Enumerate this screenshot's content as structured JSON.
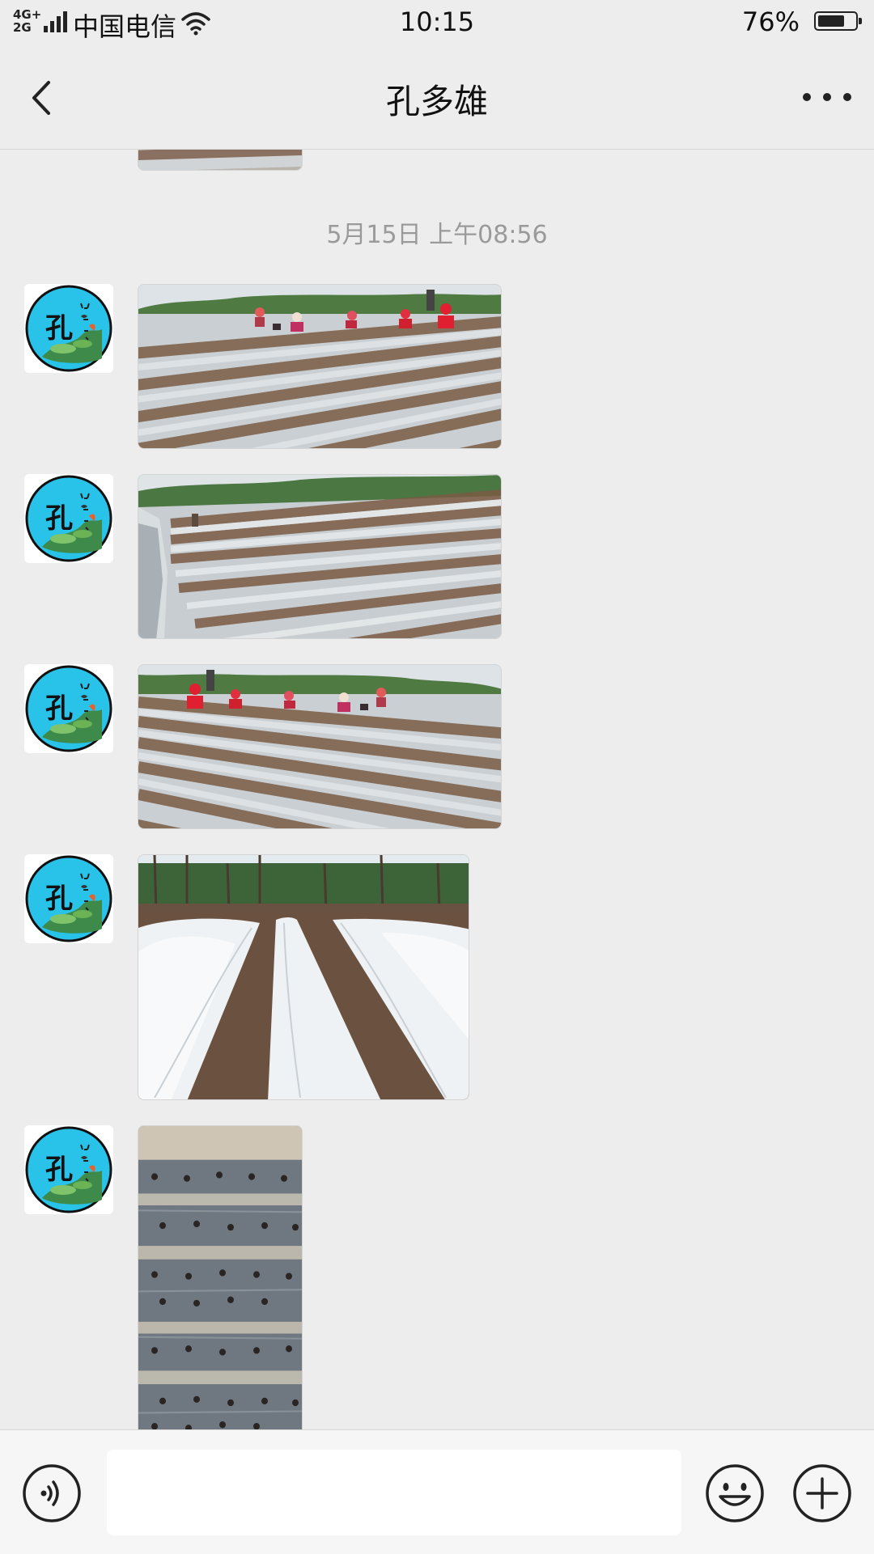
{
  "status_bar": {
    "network_top": "4G+",
    "network_bottom": "2G",
    "carrier": "中国电信",
    "time": "10:15",
    "battery_percent": "76%",
    "battery_level": 0.76
  },
  "header": {
    "title": "孔多雄"
  },
  "chat": {
    "timestamp": "5月15日 上午08:56",
    "avatar": {
      "text": "孔",
      "colors": {
        "background": "#29c3e9",
        "border": "#101010"
      }
    },
    "messages": [
      {
        "type": "image",
        "subject": "field-planting"
      },
      {
        "type": "image",
        "subject": "field-rows-car"
      },
      {
        "type": "image",
        "subject": "field-planting"
      },
      {
        "type": "image",
        "subject": "greenhouse-tunnels"
      },
      {
        "type": "image",
        "subject": "mulch-film-seedlings"
      }
    ]
  },
  "input_bar": {
    "text_value": "",
    "icons": [
      "voice-icon",
      "emoji-icon",
      "plus-icon"
    ]
  },
  "colors": {
    "background": "#ededed",
    "timestamp": "#9a9a9a",
    "input_bar": "#f6f6f6"
  }
}
